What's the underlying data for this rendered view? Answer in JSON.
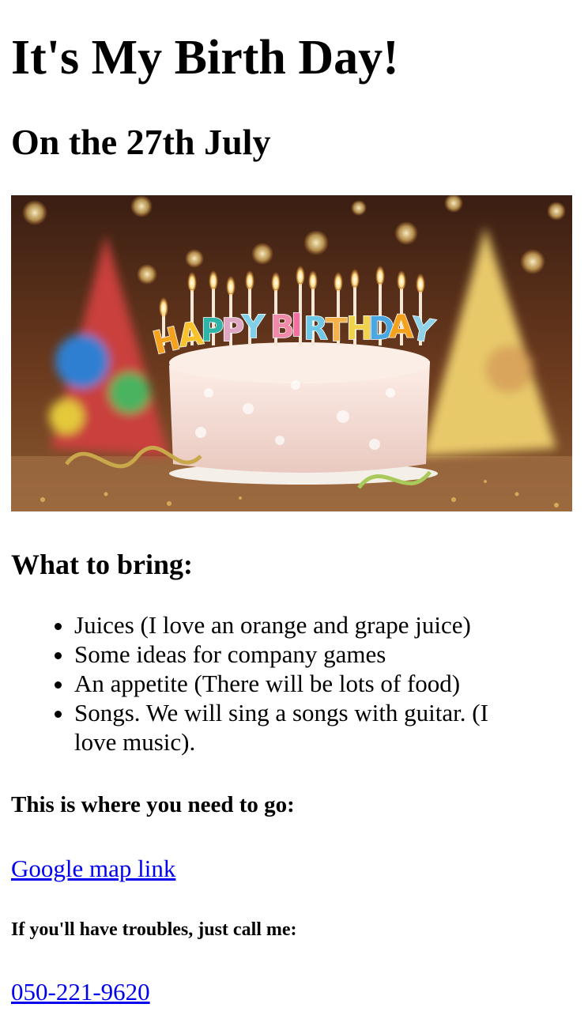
{
  "header": {
    "title": "It's My Birth Day!",
    "date": "On the 27th July"
  },
  "hero": {
    "candle_letters": [
      "H",
      "A",
      "P",
      "P",
      "Y",
      "B",
      "I",
      "R",
      "T",
      "H",
      "D",
      "A",
      "Y"
    ]
  },
  "bring": {
    "heading": "What to bring:",
    "items": [
      "Juices (I love an orange and grape juice)",
      "Some ideas for company games",
      "An appetite (There will be lots of food)",
      "Songs. We will sing a songs with guitar. (I love music)."
    ]
  },
  "location": {
    "heading": "This is where you need to go:",
    "link_text": "Google map link"
  },
  "contact": {
    "heading": "If you'll have troubles, just call me:",
    "phone": "050-221-9620"
  }
}
